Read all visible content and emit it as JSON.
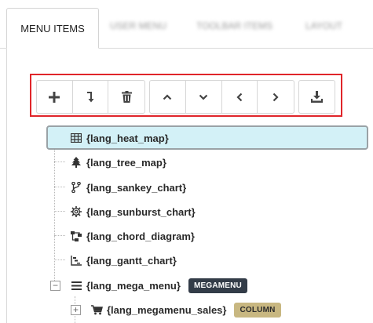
{
  "tabs": [
    {
      "label": "MENU ITEMS",
      "active": true
    },
    {
      "label": "USER MENU",
      "active": false
    },
    {
      "label": "TOOLBAR ITEMS",
      "active": false
    },
    {
      "label": "LAYOUT",
      "active": false
    }
  ],
  "toolbar": {
    "highlight_color": "#e0252a",
    "groups": [
      [
        "plus-icon",
        "insert-below-icon",
        "trash-icon"
      ],
      [
        "chevron-up-icon",
        "chevron-down-icon",
        "chevron-left-icon",
        "chevron-right-icon"
      ],
      [
        "download-icon"
      ]
    ]
  },
  "tree": {
    "items": [
      {
        "label": "{lang_heat_map}",
        "icon": "table-icon",
        "selected": true
      },
      {
        "label": "{lang_tree_map}",
        "icon": "tree-icon"
      },
      {
        "label": "{lang_sankey_chart}",
        "icon": "code-branch-icon"
      },
      {
        "label": "{lang_sunburst_chart}",
        "icon": "gear-icon"
      },
      {
        "label": "{lang_chord_diagram}",
        "icon": "sitemap-icon"
      },
      {
        "label": "{lang_gantt_chart}",
        "icon": "gantt-icon"
      },
      {
        "label": "{lang_mega_menu}",
        "icon": "bars-icon",
        "badge": "MEGAMENU",
        "expanded": true
      },
      {
        "label": "{lang_megamenu_sales}",
        "icon": "cart-icon",
        "badge": "COLUMN",
        "expanded": false
      }
    ],
    "selected_color": "#d3f1f7",
    "badge_colors": {
      "MEGAMENU": "#333c48",
      "COLUMN": "#c8b781"
    }
  }
}
